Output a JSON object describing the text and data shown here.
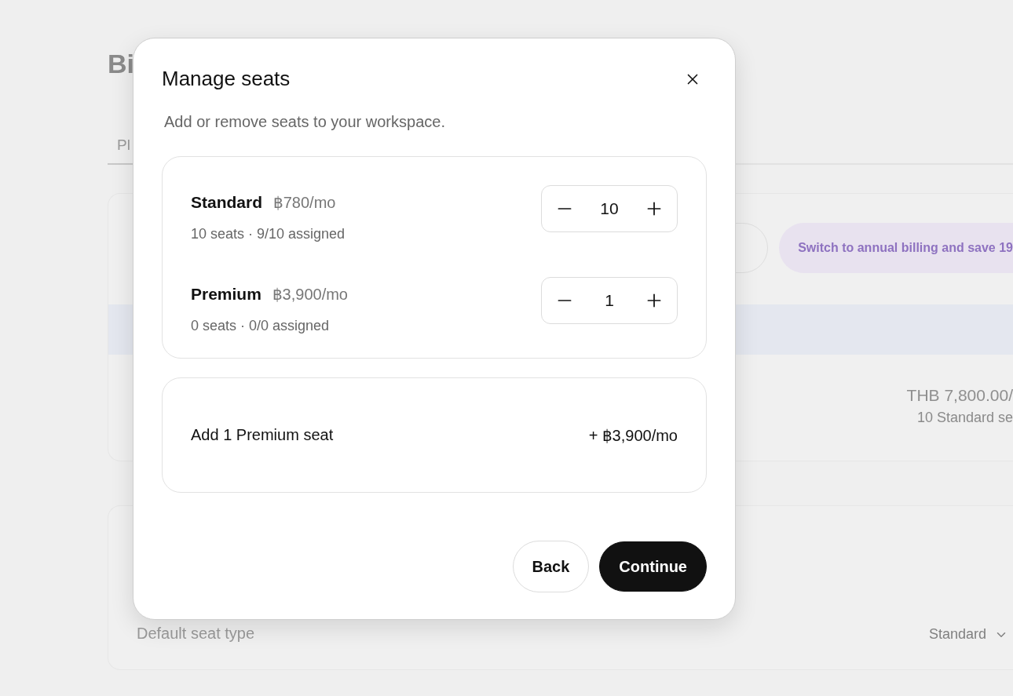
{
  "background": {
    "title": "Bi",
    "tabs": [
      {
        "label": "Pl",
        "selected": true
      }
    ],
    "promo": "Switch to annual billing and save 19",
    "total": "THB 7,800.00/",
    "total_note": "10 Standard se",
    "default_seat_label": "Default seat type",
    "default_seat_value": "Standard"
  },
  "dialog": {
    "title": "Manage seats",
    "subtitle": "Add or remove seats to your workspace.",
    "seat_types": [
      {
        "name": "Standard",
        "price": "฿780/mo",
        "details": "10 seats · 9/10 assigned",
        "count": "10"
      },
      {
        "name": "Premium",
        "price": "฿3,900/mo",
        "details": "0 seats · 0/0 assigned",
        "count": "1"
      }
    ],
    "summary": {
      "label": "Add 1 Premium seat",
      "amount": "+ ฿3,900/mo"
    },
    "buttons": [
      {
        "label": "Back",
        "kind": "secondary"
      },
      {
        "label": "Continue",
        "kind": "primary"
      }
    ]
  }
}
